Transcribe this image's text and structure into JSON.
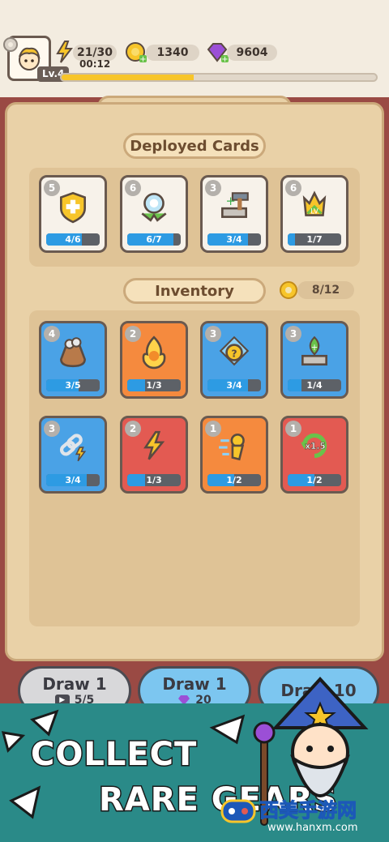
{
  "header": {
    "level": "Lv.4",
    "energy": "21/30",
    "timer": "00:12",
    "gold": "1340",
    "gems": "9604",
    "xp_fraction": 0.42
  },
  "deployed": {
    "title": "Deployed Cards",
    "cards": [
      {
        "badge": "5",
        "progress": "4/6",
        "fill": 0.67,
        "icon": "shield-plus-icon",
        "color": "white"
      },
      {
        "badge": "6",
        "progress": "6/7",
        "fill": 0.86,
        "icon": "gear-wreath-icon",
        "color": "white"
      },
      {
        "badge": "3",
        "progress": "3/4",
        "fill": 0.75,
        "icon": "hammer-anvil-icon",
        "color": "white"
      },
      {
        "badge": "6",
        "progress": "1/7",
        "fill": 0.14,
        "icon": "hero-level-up-icon",
        "color": "white"
      }
    ]
  },
  "inventory": {
    "title": "Inventory",
    "capacity": "8/12",
    "cards": [
      {
        "badge": "4",
        "progress": "3/5",
        "fill": 0.6,
        "icon": "coin-bag-icon",
        "color": "blue"
      },
      {
        "badge": "2",
        "progress": "1/3",
        "fill": 0.33,
        "icon": "fire-hero-icon",
        "color": "orange"
      },
      {
        "badge": "3",
        "progress": "3/4",
        "fill": 0.75,
        "icon": "mystery-hero-icon",
        "color": "blue"
      },
      {
        "badge": "3",
        "progress": "1/4",
        "fill": 0.25,
        "icon": "anvil-upgrade-icon",
        "color": "blue"
      },
      {
        "badge": "3",
        "progress": "3/4",
        "fill": 0.75,
        "icon": "chain-bolt-icon",
        "color": "blue"
      },
      {
        "badge": "2",
        "progress": "1/3",
        "fill": 0.33,
        "icon": "lightning-icon",
        "color": "red"
      },
      {
        "badge": "1",
        "progress": "1/2",
        "fill": 0.5,
        "icon": "dash-hero-icon",
        "color": "orange"
      },
      {
        "badge": "1",
        "progress": "1/2",
        "fill": 0.5,
        "icon": "speed-x1.5-icon",
        "color": "red",
        "label": "x1.5"
      }
    ]
  },
  "draw": {
    "draw1_ad": {
      "label": "Draw 1",
      "count": "5/5"
    },
    "draw1_gem": {
      "label": "Draw 1",
      "cost": "20"
    },
    "draw10": {
      "label": "Draw 10"
    }
  },
  "promo": {
    "line1": "COLLECT",
    "line2": "RARE GEARS",
    "watermark": "西美手游网",
    "watermark_url": "www.hanxm.com"
  },
  "colors": {
    "accent": "#2d9be3",
    "gold": "#f7c52a",
    "gem": "#9b4fd6",
    "panel": "#e9d1a7"
  }
}
